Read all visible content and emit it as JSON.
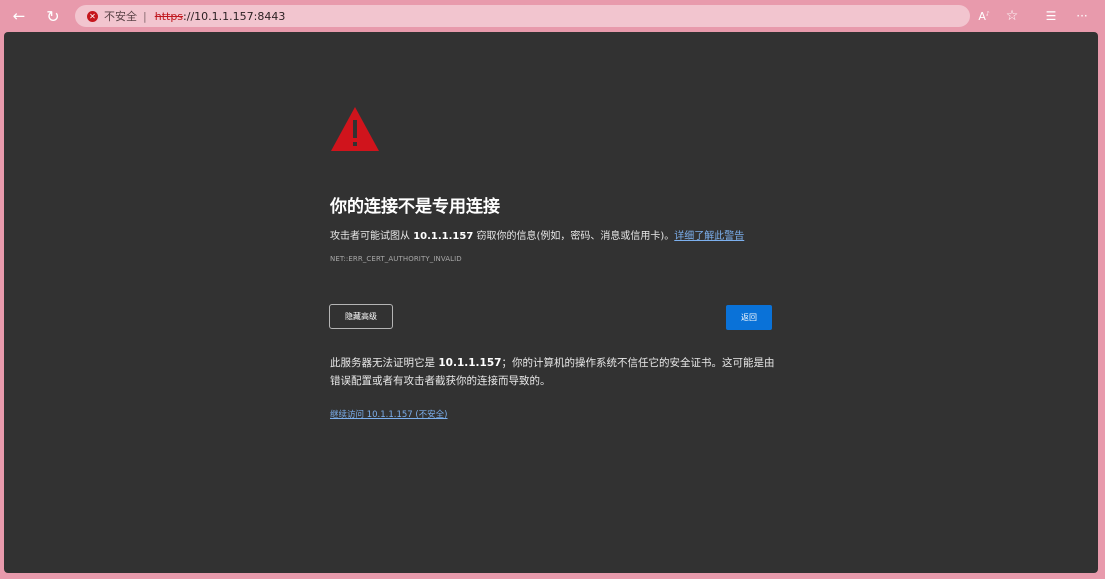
{
  "toolbar": {
    "back_glyph": "←",
    "refresh_glyph": "↻",
    "address": {
      "error_glyph": "✕",
      "insecure_label": "不安全",
      "separator": "|",
      "scheme": "https",
      "rest": "://10.1.1.157:8443"
    },
    "icons": {
      "read_aloud": "A",
      "favorite": "☆",
      "favorites_list": "☰",
      "more": "···"
    }
  },
  "page": {
    "title": "你的连接不是专用连接",
    "desc_prefix": "攻击者可能试图从 ",
    "desc_host": "10.1.1.157",
    "desc_suffix": " 窃取你的信息(例如，密码、消息或信用卡)。",
    "learn_more_link": "详细了解此警告",
    "error_code": "NET::ERR_CERT_AUTHORITY_INVALID",
    "hide_advanced_button": "隐藏高级",
    "back_button": "返回",
    "detail_prefix": "此服务器无法证明它是 ",
    "detail_host": "10.1.1.157",
    "detail_suffix": "；你的计算机的操作系统不信任它的安全证书。这可能是由错误配置或者有攻击者截获你的连接而导致的。",
    "proceed_link": "继续访问 10.1.1.157 (不安全)"
  },
  "colors": {
    "warning_red": "#d0141c",
    "link_blue": "#7cb0ee",
    "primary_blue": "#0a72d8",
    "background": "#323232"
  }
}
